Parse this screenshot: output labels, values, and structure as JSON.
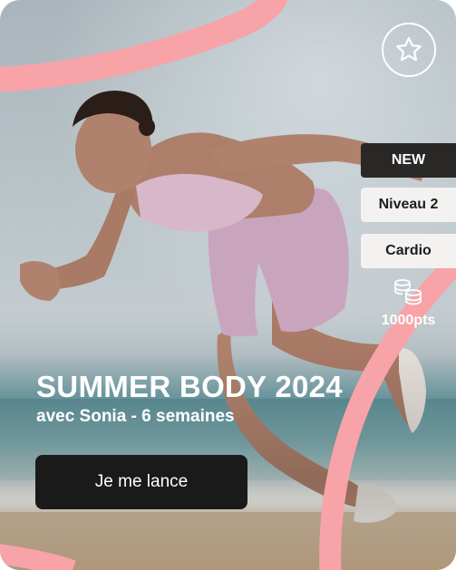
{
  "card": {
    "title": "SUMMER BODY 2024",
    "subtitle": "avec Sonia - 6 semaines",
    "cta_label": "Je me lance",
    "favorite_icon": "star-outline-icon",
    "tags": {
      "new": "NEW",
      "level": "Niveau 2",
      "category": "Cardio"
    },
    "points_icon": "coins-stack-icon",
    "points": "1000pts"
  },
  "colors": {
    "accent_ribbon": "#f7a3a8",
    "cta_background": "#1a1a1a",
    "new_badge": "#2a2826",
    "tag_background": "#f3f2f0"
  }
}
